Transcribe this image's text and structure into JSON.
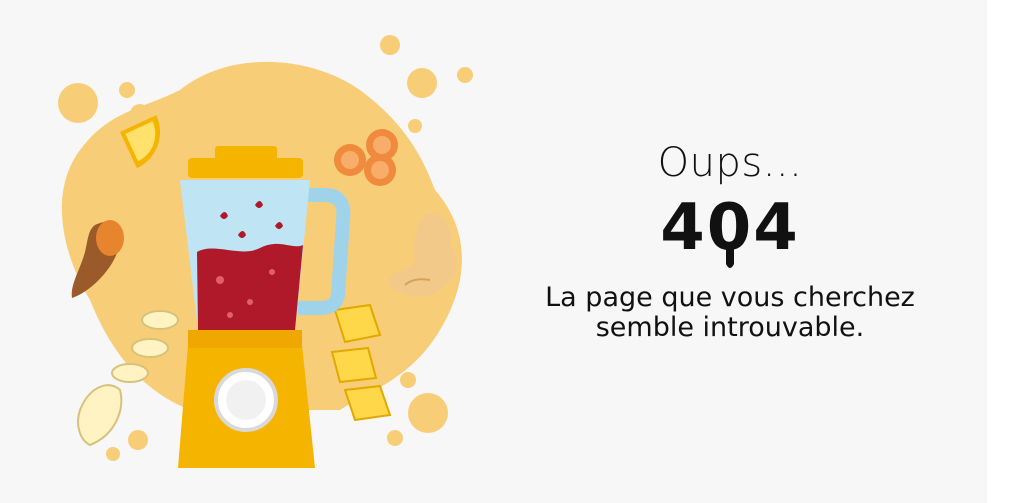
{
  "error": {
    "heading": "Oups...",
    "code": "404",
    "message": "La page que vous cherchez semble introuvable."
  },
  "illustration": {
    "name": "blender with fruits and vegetables",
    "icons": [
      "lemon-slice-icon",
      "carrot-slices-icon",
      "ginger-icon",
      "taro-root-icon",
      "banana-icon",
      "pineapple-chunks-icon",
      "blender-icon"
    ]
  },
  "colors": {
    "background": "#f7f7f7",
    "blob": "#f8cd77",
    "text": "#111111",
    "blender_base": "#f5b400",
    "smoothie": "#b0192a"
  }
}
